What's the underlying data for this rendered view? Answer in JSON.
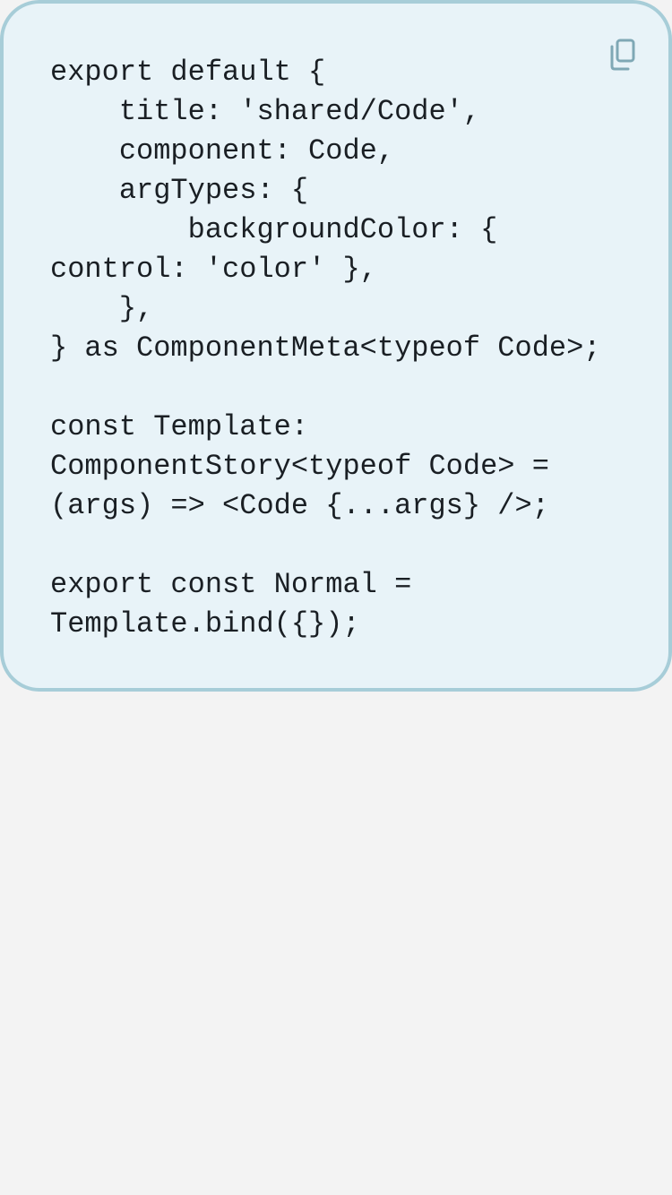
{
  "code_block": {
    "copy_icon": "copy-icon",
    "code": "export default {\n    title: 'shared/Code',\n    component: Code,\n    argTypes: {\n        backgroundColor: {\ncontrol: 'color' },\n    },\n} as ComponentMeta<typeof Code>;\n\nconst Template:\nComponentStory<typeof Code> =\n(args) => <Code {...args} />;\n\nexport const Normal =\nTemplate.bind({});"
  },
  "colors": {
    "card_background": "#e8f3f8",
    "card_border": "#a7cdd8",
    "text": "#1a1f24",
    "icon": "#7fa8b5",
    "page_background": "#f3f3f3"
  }
}
